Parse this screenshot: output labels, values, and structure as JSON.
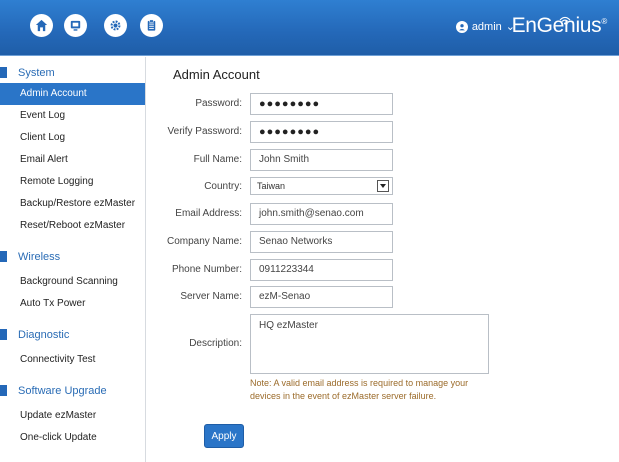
{
  "header": {
    "user": "admin",
    "brand": "EnGenius",
    "brand_mark": "®",
    "icons": [
      "home-icon",
      "monitor-icon",
      "gear-icon",
      "clipboard-icon"
    ]
  },
  "sidebar": {
    "sections": [
      {
        "label": "System",
        "items": [
          "Admin Account",
          "Event Log",
          "Client Log",
          "Email Alert",
          "Remote Logging",
          "Backup/Restore ezMaster",
          "Reset/Reboot ezMaster"
        ]
      },
      {
        "label": "Wireless",
        "items": [
          "Background Scanning",
          "Auto Tx Power"
        ]
      },
      {
        "label": "Diagnostic",
        "items": [
          "Connectivity Test"
        ]
      },
      {
        "label": "Software Upgrade",
        "items": [
          "Update ezMaster",
          "One-click Update"
        ]
      }
    ],
    "active": "Admin Account"
  },
  "form": {
    "title": "Admin Account",
    "password": {
      "label": "Password:",
      "value": "●●●●●●●●"
    },
    "verify_password": {
      "label": "Verify Password:",
      "value": "●●●●●●●●"
    },
    "full_name": {
      "label": "Full Name:",
      "value": "John Smith"
    },
    "country": {
      "label": "Country:",
      "value": "Taiwan"
    },
    "email": {
      "label": "Email Address:",
      "value": "john.smith@senao.com"
    },
    "company": {
      "label": "Company Name:",
      "value": "Senao Networks"
    },
    "phone": {
      "label": "Phone Number:",
      "value": "0911223344"
    },
    "server": {
      "label": "Server Name:",
      "value": "ezM-Senao"
    },
    "description": {
      "label": "Description:",
      "value": "HQ ezMaster"
    },
    "note_line1": "Note: A valid email address is required to manage your",
    "note_line2": "devices in the event of ezMaster server failure.",
    "apply_label": "Apply"
  },
  "colors": {
    "header": "#2468b8",
    "accent": "#2a75c8",
    "note": "#9b6b2a"
  }
}
